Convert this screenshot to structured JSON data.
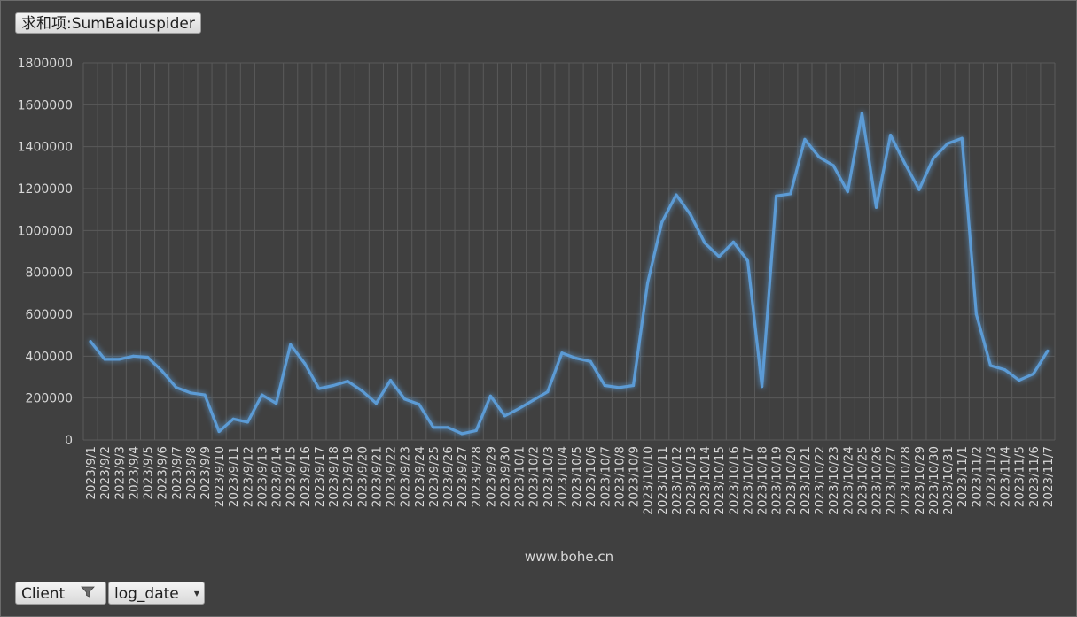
{
  "pivot": {
    "value_field": "求和项:SumBaiduspider",
    "filter_field": "Client",
    "axis_field": "log_date"
  },
  "watermark": "www.bohe.cn",
  "colors": {
    "background": "#404040",
    "line": "#5b9bd5",
    "grid": "#5a5a5a",
    "text": "#d9d9d9"
  },
  "icons": {
    "filter": "filter-funnel-icon",
    "dropdown": "dropdown-arrow-icon"
  },
  "chart_data": {
    "type": "line",
    "title": "",
    "xlabel": "",
    "ylabel": "",
    "ylim": [
      0,
      1800000
    ],
    "yticks": [
      0,
      200000,
      400000,
      600000,
      800000,
      1000000,
      1200000,
      1400000,
      1600000,
      1800000
    ],
    "grid": true,
    "legend": "none",
    "categories": [
      "2023/9/1",
      "2023/9/2",
      "2023/9/3",
      "2023/9/4",
      "2023/9/5",
      "2023/9/6",
      "2023/9/7",
      "2023/9/8",
      "2023/9/9",
      "2023/9/10",
      "2023/9/11",
      "2023/9/12",
      "2023/9/13",
      "2023/9/14",
      "2023/9/15",
      "2023/9/16",
      "2023/9/17",
      "2023/9/18",
      "2023/9/19",
      "2023/9/20",
      "2023/9/21",
      "2023/9/22",
      "2023/9/23",
      "2023/9/24",
      "2023/9/25",
      "2023/9/26",
      "2023/9/27",
      "2023/9/28",
      "2023/9/29",
      "2023/9/30",
      "2023/10/1",
      "2023/10/2",
      "2023/10/3",
      "2023/10/4",
      "2023/10/5",
      "2023/10/6",
      "2023/10/7",
      "2023/10/8",
      "2023/10/9",
      "2023/10/10",
      "2023/10/11",
      "2023/10/12",
      "2023/10/13",
      "2023/10/14",
      "2023/10/15",
      "2023/10/16",
      "2023/10/17",
      "2023/10/18",
      "2023/10/19",
      "2023/10/20",
      "2023/10/21",
      "2023/10/22",
      "2023/10/23",
      "2023/10/24",
      "2023/10/25",
      "2023/10/26",
      "2023/10/27",
      "2023/10/28",
      "2023/10/29",
      "2023/10/30",
      "2023/10/31",
      "2023/11/1",
      "2023/11/2",
      "2023/11/3",
      "2023/11/4",
      "2023/11/5",
      "2023/11/6",
      "2023/11/7"
    ],
    "series": [
      {
        "name": "",
        "values": [
          470000,
          385000,
          385000,
          400000,
          395000,
          330000,
          250000,
          225000,
          215000,
          40000,
          100000,
          85000,
          215000,
          175000,
          455000,
          365000,
          245000,
          260000,
          280000,
          235000,
          175000,
          285000,
          195000,
          170000,
          60000,
          60000,
          30000,
          45000,
          210000,
          115000,
          150000,
          190000,
          230000,
          415000,
          390000,
          375000,
          260000,
          250000,
          260000,
          750000,
          1040000,
          1170000,
          1075000,
          940000,
          875000,
          945000,
          855000,
          255000,
          1165000,
          1175000,
          1435000,
          1350000,
          1310000,
          1185000,
          1560000,
          1110000,
          1455000,
          1320000,
          1195000,
          1345000,
          1415000,
          1440000,
          600000,
          355000,
          335000,
          285000,
          315000,
          425000
        ]
      }
    ]
  }
}
